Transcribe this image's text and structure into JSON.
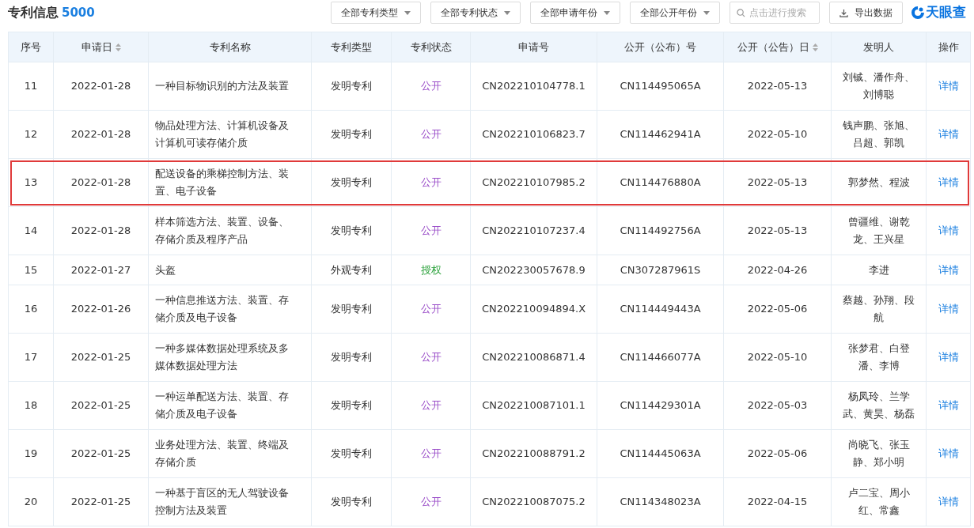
{
  "header": {
    "title": "专利信息",
    "count": "5000",
    "filters": [
      "全部专利类型",
      "全部专利状态",
      "全部申请年份",
      "全部公开年份"
    ],
    "search": {
      "placeholder": "点击进行搜索"
    },
    "export_button": "导出数据",
    "logo": "天眼查"
  },
  "table": {
    "columns": [
      {
        "label": "序号",
        "sortable": false
      },
      {
        "label": "申请日",
        "sortable": true
      },
      {
        "label": "专利名称",
        "sortable": false
      },
      {
        "label": "专利类型",
        "sortable": false
      },
      {
        "label": "专利状态",
        "sortable": false
      },
      {
        "label": "申请号",
        "sortable": false
      },
      {
        "label": "公开（公布）号",
        "sortable": false
      },
      {
        "label": "公开（公告）日",
        "sortable": true
      },
      {
        "label": "发明人",
        "sortable": false
      },
      {
        "label": "操作",
        "sortable": false
      }
    ],
    "rows": [
      {
        "no": "11",
        "date": "2022-01-28",
        "name": "一种目标物识别的方法及装置",
        "type": "发明专利",
        "status": "公开",
        "kind": "published",
        "app_no": "CN202210104778.1",
        "pub_no": "CN114495065A",
        "pub_date": "2022-05-13",
        "inventors": "刘铖、潘作舟、刘博聪",
        "action": "详情",
        "highlighted": false
      },
      {
        "no": "12",
        "date": "2022-01-28",
        "name": "物品处理方法、计算机设备及计算机可读存储介质",
        "type": "发明专利",
        "status": "公开",
        "kind": "published",
        "app_no": "CN202210106823.7",
        "pub_no": "CN114462941A",
        "pub_date": "2022-05-10",
        "inventors": "钱声鹏、张旭、吕超、郭凯",
        "action": "详情",
        "highlighted": false
      },
      {
        "no": "13",
        "date": "2022-01-28",
        "name": "配送设备的乘梯控制方法、装置、电子设备",
        "type": "发明专利",
        "status": "公开",
        "kind": "published",
        "app_no": "CN202210107985.2",
        "pub_no": "CN114476880A",
        "pub_date": "2022-05-13",
        "inventors": "郭梦然、程波",
        "action": "详情",
        "highlighted": true
      },
      {
        "no": "14",
        "date": "2022-01-28",
        "name": "样本筛选方法、装置、设备、存储介质及程序产品",
        "type": "发明专利",
        "status": "公开",
        "kind": "published",
        "app_no": "CN202210107237.4",
        "pub_no": "CN114492756A",
        "pub_date": "2022-05-13",
        "inventors": "曾疆维、谢乾龙、王兴星",
        "action": "详情",
        "highlighted": false
      },
      {
        "no": "15",
        "date": "2022-01-27",
        "name": "头盔",
        "type": "外观专利",
        "status": "授权",
        "kind": "granted",
        "app_no": "CN202230057678.9",
        "pub_no": "CN307287961S",
        "pub_date": "2022-04-26",
        "inventors": "李进",
        "action": "详情",
        "highlighted": false
      },
      {
        "no": "16",
        "date": "2022-01-26",
        "name": "一种信息推送方法、装置、存储介质及电子设备",
        "type": "发明专利",
        "status": "公开",
        "kind": "published",
        "app_no": "CN202210094894.X",
        "pub_no": "CN114449443A",
        "pub_date": "2022-05-06",
        "inventors": "蔡越、孙翔、段航",
        "action": "详情",
        "highlighted": false
      },
      {
        "no": "17",
        "date": "2022-01-25",
        "name": "一种多媒体数据处理系统及多媒体数据处理方法",
        "type": "发明专利",
        "status": "公开",
        "kind": "published",
        "app_no": "CN202210086871.4",
        "pub_no": "CN114466077A",
        "pub_date": "2022-05-10",
        "inventors": "张梦君、白登潘、李博",
        "action": "详情",
        "highlighted": false
      },
      {
        "no": "18",
        "date": "2022-01-25",
        "name": "一种运单配送方法、装置、存储介质及电子设备",
        "type": "发明专利",
        "status": "公开",
        "kind": "published",
        "app_no": "CN202210087101.1",
        "pub_no": "CN114429301A",
        "pub_date": "2022-05-03",
        "inventors": "杨凤玲、兰学武、黄昊、杨磊",
        "action": "详情",
        "highlighted": false
      },
      {
        "no": "19",
        "date": "2022-01-25",
        "name": "业务处理方法、装置、终端及存储介质",
        "type": "发明专利",
        "status": "公开",
        "kind": "published",
        "app_no": "CN202210088791.2",
        "pub_no": "CN114445063A",
        "pub_date": "2022-05-06",
        "inventors": "尚晓飞、张玉静、郑小明",
        "action": "详情",
        "highlighted": false
      },
      {
        "no": "20",
        "date": "2022-01-25",
        "name": "一种基于盲区的无人驾驶设备控制方法及装置",
        "type": "发明专利",
        "status": "公开",
        "kind": "published",
        "app_no": "CN202210087075.2",
        "pub_no": "CN114348023A",
        "pub_date": "2022-04-15",
        "inventors": "卢二宝、周小红、常鑫",
        "action": "详情",
        "highlighted": false
      }
    ]
  }
}
